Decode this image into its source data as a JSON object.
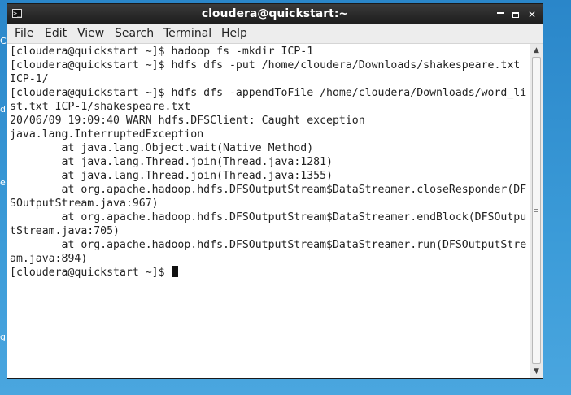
{
  "window": {
    "title": "cloudera@quickstart:~",
    "buttons": {
      "minimize": "✕",
      "maximize": "□",
      "close": "✕"
    }
  },
  "menu": [
    "File",
    "Edit",
    "View",
    "Search",
    "Terminal",
    "Help"
  ],
  "terminal": {
    "lines": [
      "[cloudera@quickstart ~]$ hadoop fs -mkdir ICP-1",
      "[cloudera@quickstart ~]$ hdfs dfs -put /home/cloudera/Downloads/shakespeare.txt",
      "ICP-1/",
      "[cloudera@quickstart ~]$ hdfs dfs -appendToFile /home/cloudera/Downloads/word_li",
      "st.txt ICP-1/shakespeare.txt",
      "20/06/09 19:09:40 WARN hdfs.DFSClient: Caught exception",
      "java.lang.InterruptedException",
      "        at java.lang.Object.wait(Native Method)",
      "        at java.lang.Thread.join(Thread.java:1281)",
      "        at java.lang.Thread.join(Thread.java:1355)",
      "        at org.apache.hadoop.hdfs.DFSOutputStream$DataStreamer.closeResponder(DF",
      "SOutputStream.java:967)",
      "        at org.apache.hadoop.hdfs.DFSOutputStream$DataStreamer.endBlock(DFSOutpu",
      "tStream.java:705)",
      "        at org.apache.hadoop.hdfs.DFSOutputStream$DataStreamer.run(DFSOutputStre",
      "am.java:894)",
      "[cloudera@quickstart ~]$ "
    ]
  },
  "desktop": {
    "edge_labels": [
      "Co",
      "d",
      "e",
      "g"
    ]
  }
}
